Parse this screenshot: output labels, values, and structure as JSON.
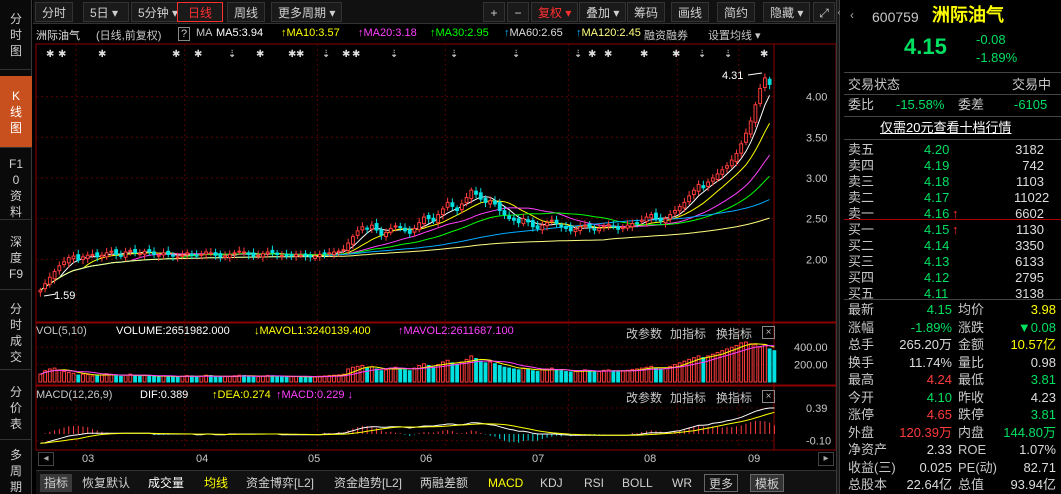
{
  "left_tabs": [
    {
      "label": "分时图",
      "active": false
    },
    {
      "label": "K线图",
      "active": true
    },
    {
      "label": "F10资料",
      "active": false
    },
    {
      "label": "深度F9",
      "active": false
    },
    {
      "label": "分时成交",
      "active": false
    },
    {
      "label": "分价表",
      "active": false
    },
    {
      "label": "多周期",
      "active": false
    }
  ],
  "toolbar": {
    "b1": "分时",
    "b2": "5日",
    "b3": "5分钟",
    "b4": "日线",
    "b5": "周线",
    "b6": "更多周期",
    "plus": "+",
    "minus": "−",
    "fq": "复权",
    "overlay": "叠加",
    "chip": "筹码",
    "draw": "画线",
    "simple": "简约",
    "hide": "隐藏",
    "expand": "⤢"
  },
  "legend": {
    "name": "洲际油气",
    "period": "(日线,前复权)",
    "q": "?",
    "ma": "MA",
    "ma5": "MA5:3.94",
    "ma10": "MA10:3.57",
    "ma20": "MA20:3.18",
    "ma30": "MA30:2.95",
    "ma60": "MA60:2.65",
    "ma120": "MA120:2.45",
    "margin": "融资融券",
    "setting": "设置均线"
  },
  "vol_legend": {
    "name": "VOL(5,10)",
    "volume": "VOLUME:2651982.000",
    "mavol1": "MAVOL1:3240139.400",
    "mavol2": "MAVOL2:2611687.100",
    "params": "改参数",
    "add": "加指标",
    "switch": "换指标",
    "close": "×"
  },
  "macd_legend": {
    "name": "MACD(12,26,9)",
    "dif": "DIF:0.389",
    "dea": "DEA:0.274",
    "macd": "MACD:0.229",
    "params": "改参数",
    "add": "加指标",
    "switch": "换指标",
    "close": "×"
  },
  "price_axis": [
    "4.00",
    "3.50",
    "3.00",
    "2.50",
    "2.00"
  ],
  "vol_axis": [
    "400.00",
    "200.00"
  ],
  "macd_axis": [
    "0.39",
    "-0.10"
  ],
  "x_axis": [
    "03",
    "04",
    "05",
    "06",
    "07",
    "08",
    "09"
  ],
  "high_label": "4.31",
  "low_label": "1.59",
  "bottom_bar": [
    "指标",
    "恢复默认",
    "成交量",
    "均线",
    "资金博弈[L2]",
    "资金趋势[L2]",
    "两融差额",
    "MACD",
    "KDJ",
    "RSI",
    "BOLL",
    "WR",
    "更多",
    "模板"
  ],
  "quote": {
    "code": "600759",
    "name": "洲际油气",
    "price": "4.15",
    "change": "-0.08",
    "pct": "-1.89%",
    "status_label": "交易状态",
    "status": "交易中",
    "wb_label": "委比",
    "wb": "-15.58%",
    "wc_label": "委差",
    "wc": "-6105",
    "promo": "仅需20元查看十档行情"
  },
  "asks": [
    {
      "label": "卖五",
      "price": "4.20",
      "vol": "3182",
      "flag": ""
    },
    {
      "label": "卖四",
      "price": "4.19",
      "vol": "742",
      "flag": ""
    },
    {
      "label": "卖三",
      "price": "4.18",
      "vol": "1103",
      "flag": ""
    },
    {
      "label": "卖二",
      "price": "4.17",
      "vol": "11022",
      "flag": ""
    },
    {
      "label": "卖一",
      "price": "4.16",
      "vol": "6602",
      "flag": "↑"
    }
  ],
  "bids": [
    {
      "label": "买一",
      "price": "4.15",
      "vol": "1130",
      "flag": "↑"
    },
    {
      "label": "买二",
      "price": "4.14",
      "vol": "3350",
      "flag": ""
    },
    {
      "label": "买三",
      "price": "4.13",
      "vol": "6133",
      "flag": ""
    },
    {
      "label": "买四",
      "price": "4.12",
      "vol": "2795",
      "flag": ""
    },
    {
      "label": "买五",
      "price": "4.11",
      "vol": "3138",
      "flag": ""
    }
  ],
  "stats": [
    {
      "l1": "最新",
      "v1": "4.15",
      "l2": "均价",
      "v2": "3.98"
    },
    {
      "l1": "涨幅",
      "v1": "-1.89%",
      "l2": "涨跌",
      "v2": "▼0.08"
    },
    {
      "l1": "总手",
      "v1": "265.20万",
      "l2": "金额",
      "v2": "10.57亿"
    },
    {
      "l1": "换手",
      "v1": "11.74%",
      "l2": "量比",
      "v2": "0.98"
    },
    {
      "l1": "最高",
      "v1": "4.24",
      "l2": "最低",
      "v2": "3.81"
    },
    {
      "l1": "今开",
      "v1": "4.10",
      "l2": "昨收",
      "v2": "4.23"
    },
    {
      "l1": "涨停",
      "v1": "4.65",
      "l2": "跌停",
      "v2": "3.81"
    },
    {
      "l1": "外盘",
      "v1": "120.39万",
      "l2": "内盘",
      "v2": "144.80万"
    },
    {
      "l1": "净资产",
      "v1": "2.33",
      "l2": "ROE",
      "v2": "1.07%"
    },
    {
      "l1": "收益(三)",
      "v1": "0.025",
      "l2": "PE(动)",
      "v2": "82.71"
    },
    {
      "l1": "总股本",
      "v1": "22.64亿",
      "l2": "总值",
      "v2": "93.94亿"
    }
  ],
  "colors": {
    "up": "#ff3c3c",
    "down": "#00e0e0",
    "ma5": "#ffffff",
    "ma10": "#ffff00",
    "ma20": "#ff40ff",
    "ma30": "#00ff00",
    "ma60": "#00aaff",
    "ma120": "#ffff80"
  },
  "chart_data": {
    "type": "candlestick",
    "price_range": [
      1.5,
      4.45
    ],
    "closes": [
      1.62,
      1.7,
      1.78,
      1.85,
      1.92,
      1.97,
      2.02,
      2.04,
      1.99,
      2.03,
      2.05,
      2.06,
      2.03,
      2.05,
      2.08,
      2.1,
      2.06,
      2.04,
      2.09,
      2.11,
      2.08,
      2.07,
      2.1,
      2.09,
      2.06,
      2.05,
      2.08,
      2.06,
      2.04,
      2.03,
      2.05,
      2.08,
      2.06,
      2.04,
      2.06,
      2.09,
      2.08,
      2.05,
      2.03,
      2.04,
      2.06,
      2.08,
      2.1,
      2.09,
      2.06,
      2.04,
      2.05,
      2.07,
      2.09,
      2.08,
      2.06,
      2.05,
      2.04,
      2.05,
      2.06,
      2.05,
      2.04,
      2.03,
      2.04,
      2.06,
      2.07,
      2.08,
      2.09,
      2.1,
      2.12,
      2.2,
      2.28,
      2.35,
      2.4,
      2.38,
      2.42,
      2.36,
      2.3,
      2.33,
      2.38,
      2.41,
      2.4,
      2.35,
      2.32,
      2.38,
      2.45,
      2.52,
      2.5,
      2.47,
      2.55,
      2.62,
      2.7,
      2.65,
      2.6,
      2.68,
      2.76,
      2.85,
      2.8,
      2.74,
      2.7,
      2.72,
      2.68,
      2.6,
      2.55,
      2.5,
      2.48,
      2.45,
      2.5,
      2.46,
      2.4,
      2.38,
      2.42,
      2.45,
      2.48,
      2.44,
      2.4,
      2.38,
      2.35,
      2.37,
      2.4,
      2.42,
      2.39,
      2.36,
      2.38,
      2.41,
      2.43,
      2.4,
      2.37,
      2.39,
      2.42,
      2.44,
      2.45,
      2.48,
      2.52,
      2.55,
      2.5,
      2.47,
      2.5,
      2.55,
      2.6,
      2.65,
      2.7,
      2.78,
      2.85,
      2.92,
      2.88,
      2.95,
      3.0,
      3.05,
      3.1,
      3.15,
      3.22,
      3.3,
      3.42,
      3.55,
      3.7,
      3.9,
      4.1,
      4.23,
      4.15
    ],
    "volumes": [
      90,
      130,
      150,
      160,
      140,
      120,
      110,
      100,
      80,
      90,
      85,
      70,
      75,
      80,
      95,
      88,
      70,
      66,
      80,
      90,
      75,
      70,
      74,
      72,
      65,
      60,
      72,
      68,
      60,
      55,
      66,
      74,
      70,
      62,
      66,
      78,
      74,
      60,
      58,
      62,
      66,
      72,
      78,
      74,
      66,
      60,
      62,
      70,
      76,
      72,
      66,
      62,
      60,
      62,
      64,
      62,
      60,
      58,
      60,
      66,
      70,
      74,
      78,
      82,
      90,
      150,
      170,
      180,
      190,
      160,
      175,
      150,
      130,
      140,
      160,
      170,
      160,
      140,
      130,
      160,
      190,
      210,
      190,
      170,
      200,
      230,
      250,
      220,
      200,
      230,
      260,
      300,
      270,
      240,
      220,
      230,
      210,
      190,
      170,
      160,
      150,
      140,
      160,
      150,
      130,
      120,
      140,
      150,
      160,
      140,
      130,
      120,
      115,
      120,
      130,
      140,
      125,
      115,
      120,
      135,
      140,
      130,
      120,
      125,
      135,
      145,
      150,
      160,
      170,
      180,
      160,
      150,
      160,
      180,
      200,
      220,
      240,
      260,
      280,
      300,
      280,
      300,
      320,
      340,
      360,
      380,
      400,
      420,
      450,
      460,
      440,
      430,
      400,
      430,
      380,
      360
    ],
    "macd_range": [
      -0.18,
      0.45
    ],
    "dif": [
      -0.14,
      -0.13,
      -0.11,
      -0.09,
      -0.07,
      -0.05,
      -0.03,
      -0.02,
      -0.01,
      0.0,
      0.01,
      0.01,
      0.01,
      0.01,
      0.01,
      0.01,
      0.01,
      0.01,
      0.01,
      0.01,
      0.01,
      0.01,
      0.01,
      0.01,
      0.0,
      0.0,
      0.0,
      0.0,
      0.0,
      0.0,
      0.0,
      0.0,
      0.0,
      -0.01,
      -0.01,
      0.0,
      0.0,
      -0.01,
      -0.01,
      -0.01,
      0.0,
      0.0,
      0.0,
      0.0,
      0.0,
      0.0,
      0.0,
      0.0,
      0.0,
      0.0,
      0.0,
      -0.01,
      -0.01,
      -0.01,
      -0.01,
      -0.01,
      -0.01,
      -0.01,
      -0.01,
      -0.01,
      0.0,
      0.0,
      0.0,
      0.01,
      0.01,
      0.03,
      0.05,
      0.07,
      0.09,
      0.1,
      0.11,
      0.11,
      0.1,
      0.1,
      0.11,
      0.11,
      0.11,
      0.1,
      0.09,
      0.1,
      0.11,
      0.12,
      0.12,
      0.12,
      0.13,
      0.14,
      0.15,
      0.15,
      0.14,
      0.14,
      0.15,
      0.17,
      0.17,
      0.16,
      0.15,
      0.14,
      0.13,
      0.11,
      0.09,
      0.07,
      0.06,
      0.04,
      0.04,
      0.03,
      0.01,
      0.0,
      0.0,
      0.0,
      0.0,
      0.0,
      -0.01,
      -0.01,
      -0.02,
      -0.02,
      -0.02,
      -0.02,
      -0.02,
      -0.02,
      -0.02,
      -0.02,
      -0.02,
      -0.02,
      -0.02,
      -0.02,
      -0.02,
      -0.01,
      -0.01,
      0.0,
      0.01,
      0.02,
      0.02,
      0.02,
      0.02,
      0.03,
      0.04,
      0.05,
      0.07,
      0.09,
      0.11,
      0.13,
      0.13,
      0.14,
      0.16,
      0.17,
      0.18,
      0.2,
      0.21,
      0.23,
      0.25,
      0.28,
      0.31,
      0.34,
      0.36,
      0.38,
      0.39,
      0.39
    ],
    "x_ticks": [
      "03",
      "04",
      "05",
      "06",
      "07",
      "08",
      "09"
    ]
  }
}
